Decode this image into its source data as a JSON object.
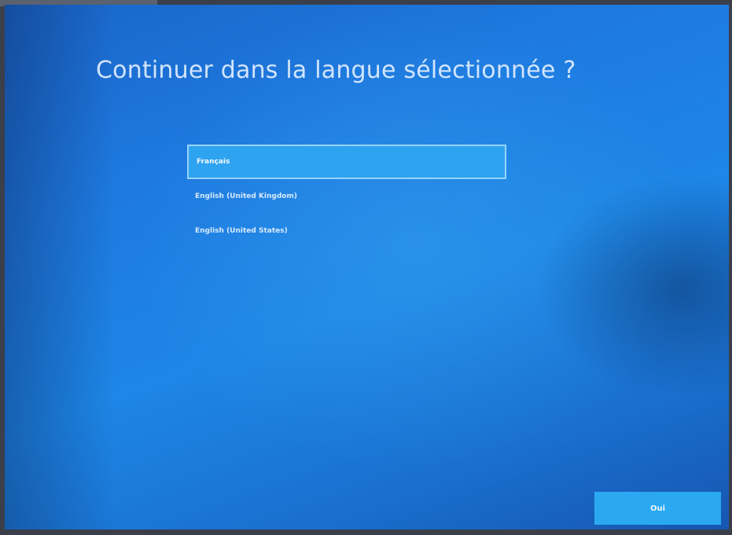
{
  "setup": {
    "title": "Continuer dans la langue sélectionnée ?",
    "languages": [
      {
        "label": "Français",
        "selected": true
      },
      {
        "label": "English (United Kingdom)",
        "selected": false
      },
      {
        "label": "English (United States)",
        "selected": false
      }
    ],
    "confirm_label": "Oui"
  },
  "colors": {
    "background": "#1e7ae0",
    "selected_item": "#2ea3f0",
    "button": "#2aa8f0",
    "text": "#e1eeff"
  }
}
